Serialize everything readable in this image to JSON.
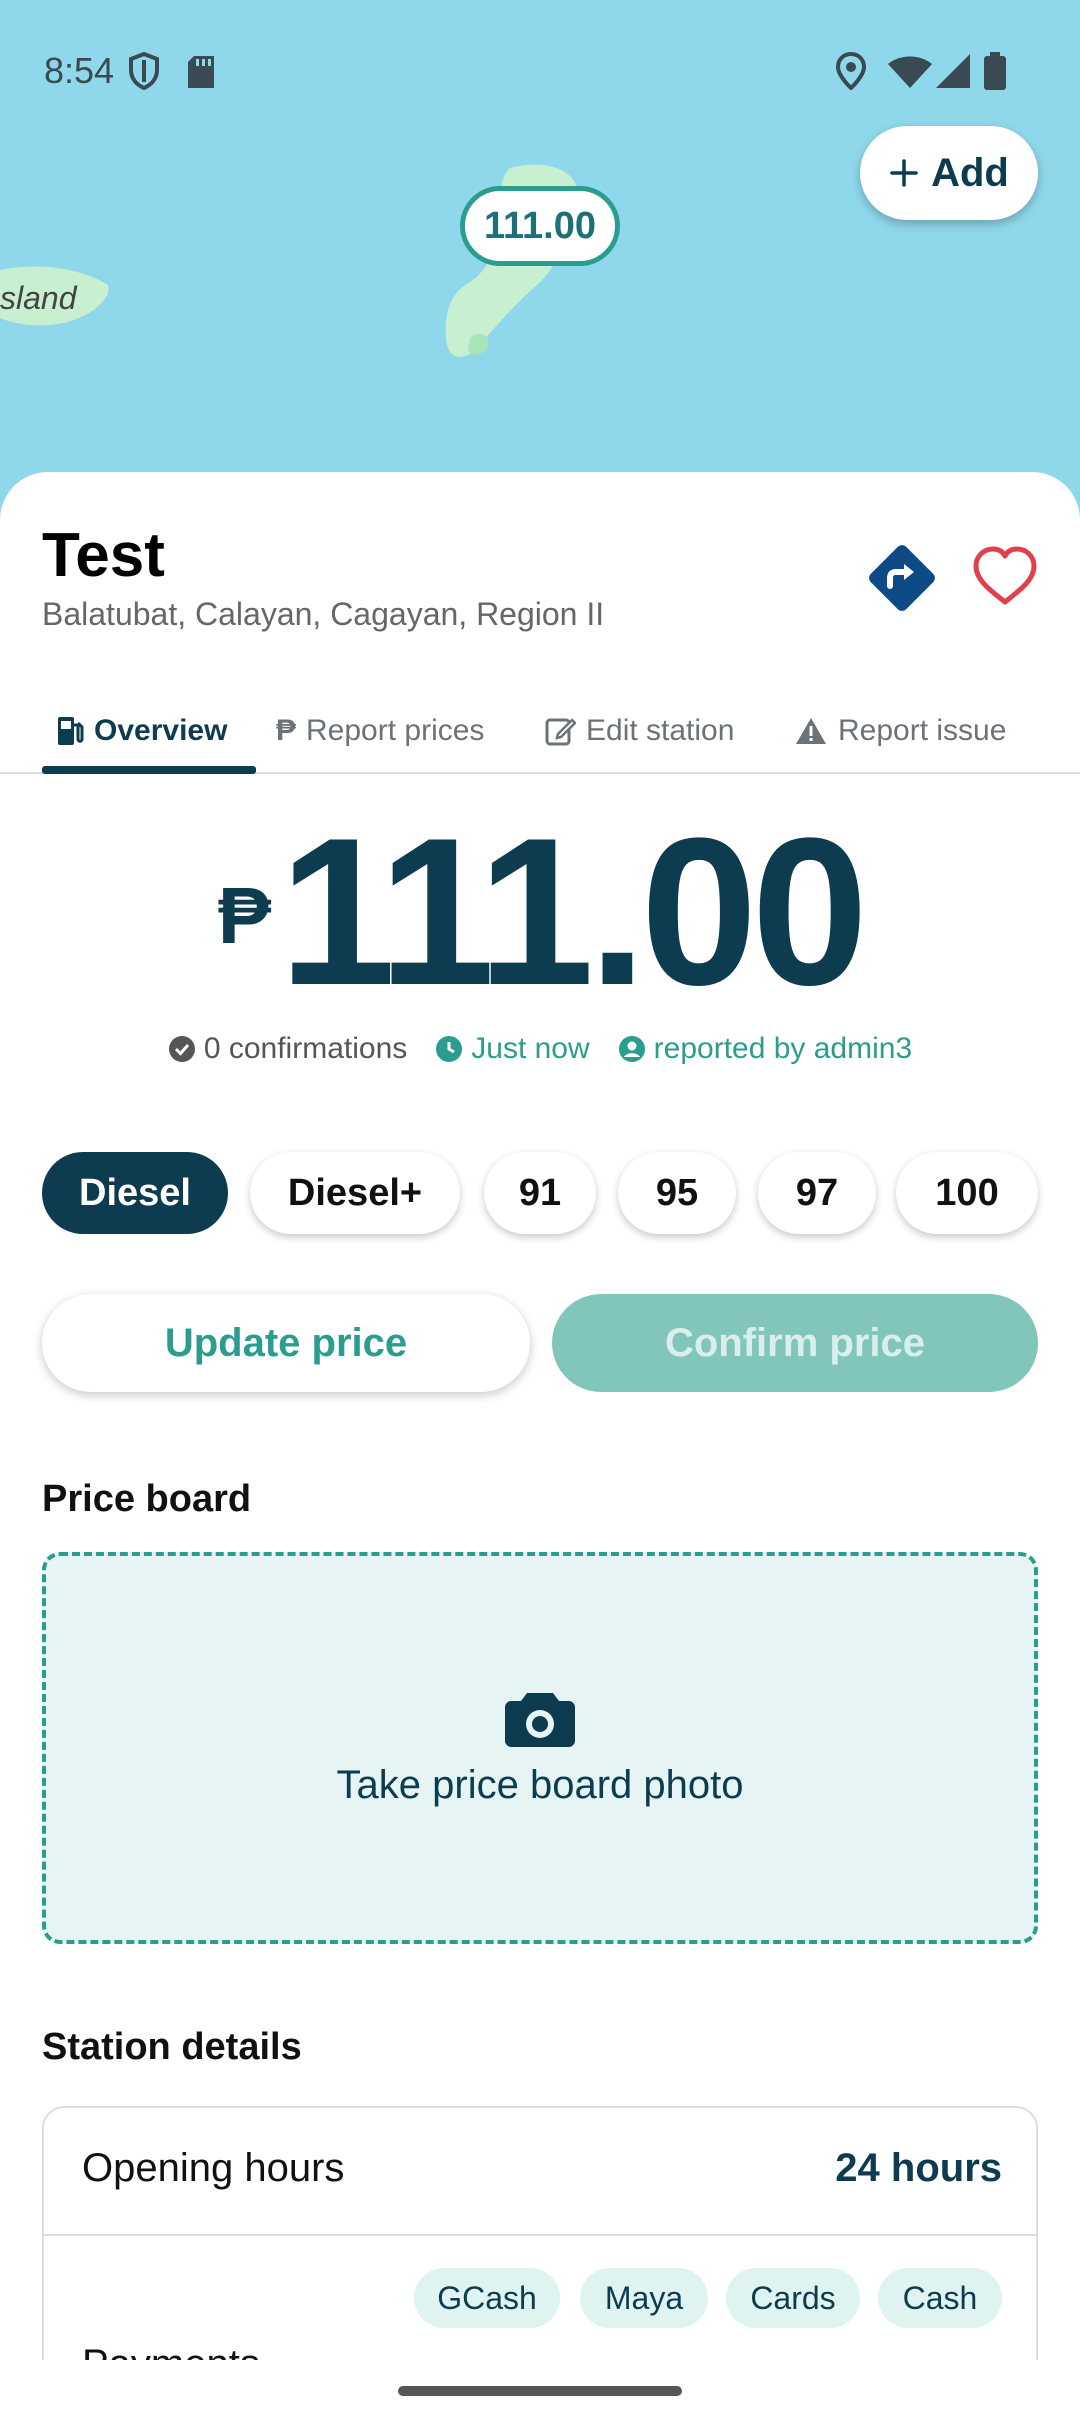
{
  "status_bar": {
    "time": "8:54"
  },
  "map": {
    "island_label": "sland",
    "price_pin": "111.00",
    "add_button_label": "Add"
  },
  "station": {
    "name": "Test",
    "address": "Balatubat, Calayan, Cagayan, Region II"
  },
  "tabs": [
    {
      "label": "Overview",
      "active": true
    },
    {
      "label": "Report prices"
    },
    {
      "label": "Edit station"
    },
    {
      "label": "Report issue"
    }
  ],
  "price": {
    "currency": "₱",
    "amount": "111.00",
    "confirmations": "0 confirmations",
    "time": "Just now",
    "reported_by": "reported by admin3"
  },
  "fuel_types": [
    "Diesel",
    "Diesel+",
    "91",
    "95",
    "97",
    "100"
  ],
  "selected_fuel": "Diesel",
  "actions": {
    "update_label": "Update price",
    "confirm_label": "Confirm price"
  },
  "price_board": {
    "title": "Price board",
    "photo_label": "Take price board photo"
  },
  "station_details": {
    "title": "Station details",
    "opening_hours_label": "Opening hours",
    "opening_hours_value": "24 hours",
    "payments_label": "Payments",
    "payments": [
      "GCash",
      "Maya",
      "Cards",
      "Cash"
    ]
  },
  "colors": {
    "primary": "#0d3b4f",
    "accent": "#2a9d8f",
    "map_water": "#8fd8ec",
    "favorite": "#e0404a"
  }
}
